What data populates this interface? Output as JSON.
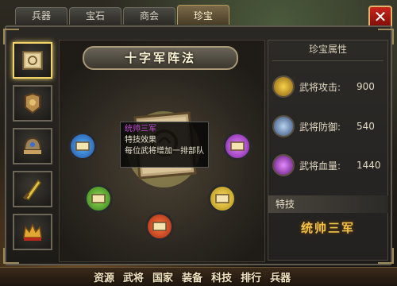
{
  "tabs": [
    "兵器",
    "宝石",
    "商会",
    "珍宝"
  ],
  "active_tab": 3,
  "close_label": "✕",
  "treasure_title": "十字军阵法",
  "tooltip": {
    "name": "统帅三军",
    "heading": "特技效果",
    "desc": "每位武将增加一排部队"
  },
  "panel": {
    "title": "珍宝属性",
    "stats": [
      {
        "label": "武将攻击:",
        "value": "900",
        "icon": "sword-icon",
        "color": "#e6b832"
      },
      {
        "label": "武将防御:",
        "value": "540",
        "icon": "shield-icon",
        "color": "#8fb0d8"
      },
      {
        "label": "武将血量:",
        "value": "1440",
        "icon": "heart-icon",
        "color": "#c24ad6"
      }
    ],
    "skill_header": "特技",
    "skill_name": "统帅三军"
  },
  "items": [
    {
      "icon": "book-icon",
      "selected": true
    },
    {
      "icon": "armor-icon"
    },
    {
      "icon": "helmet-icon"
    },
    {
      "icon": "blade-icon"
    },
    {
      "icon": "crown-icon"
    }
  ],
  "nav": [
    "资源",
    "武将",
    "国家",
    "装备",
    "科技",
    "排行",
    "兵器"
  ]
}
